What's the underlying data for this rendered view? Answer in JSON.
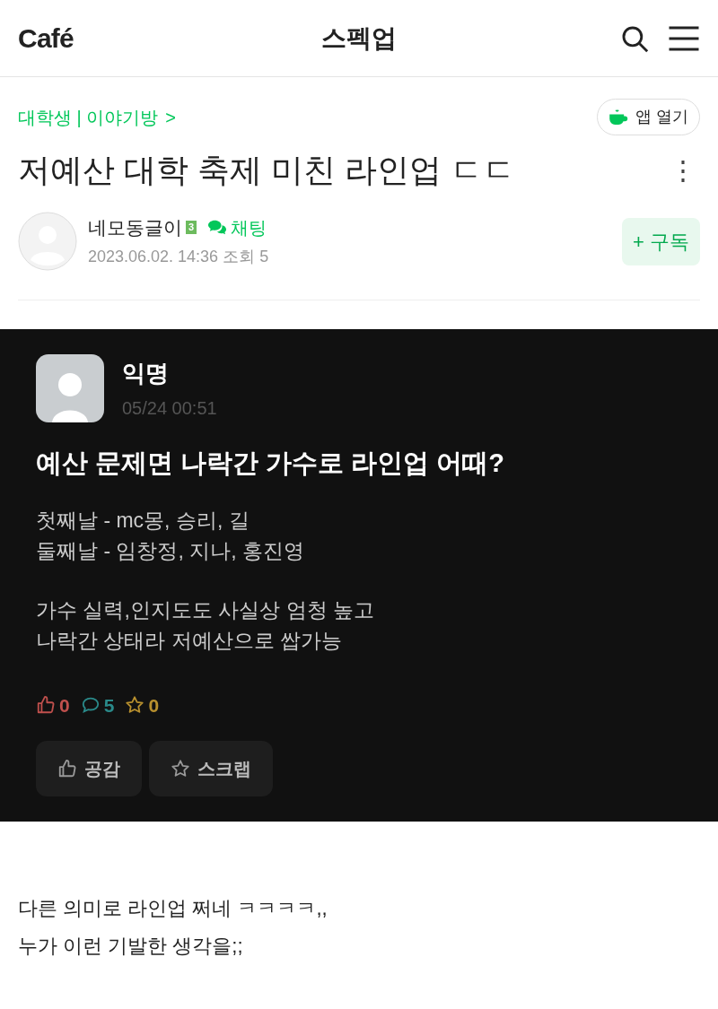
{
  "header": {
    "logo": "Café",
    "title": "스펙업"
  },
  "breadcrumb": {
    "board": "대학생 | 이야기방",
    "chevron": ">"
  },
  "app_button": {
    "label": "앱 열기"
  },
  "post": {
    "title": "저예산 대학 축제 미친 라인업 ㄷㄷ",
    "more": "⋮",
    "author": {
      "name": "네모동글이",
      "level": "3",
      "chat": "채팅",
      "meta": "2023.06.02. 14:36 조회 5"
    },
    "subscribe": {
      "label": "+ 구독"
    }
  },
  "embedded": {
    "author": "익명",
    "time": "05/24 00:51",
    "title": "예산 문제면 나락간 가수로 라인업 어때?",
    "paragraphs": [
      [
        "첫째날 - mc몽, 승리, 길",
        "둘째날 - 임창정, 지나, 홍진영"
      ],
      [
        "가수 실력,인지도도 사실상 엄청 높고",
        "나락간 상태라 저예산으로 쌉가능"
      ]
    ],
    "stats": [
      {
        "kind": "like",
        "count": "0",
        "color": "#c0504d"
      },
      {
        "kind": "comment",
        "count": "5",
        "color": "#2a8a8a"
      },
      {
        "kind": "scrap",
        "count": "0",
        "color": "#b8902e"
      }
    ],
    "buttons": [
      {
        "kind": "like",
        "label": "공감"
      },
      {
        "kind": "scrap",
        "label": "스크랩"
      }
    ]
  },
  "body": [
    "다른 의미로 라인업 쩌네 ㅋㅋㅋㅋ,,",
    "누가 이런 기발한 생각을;;"
  ]
}
